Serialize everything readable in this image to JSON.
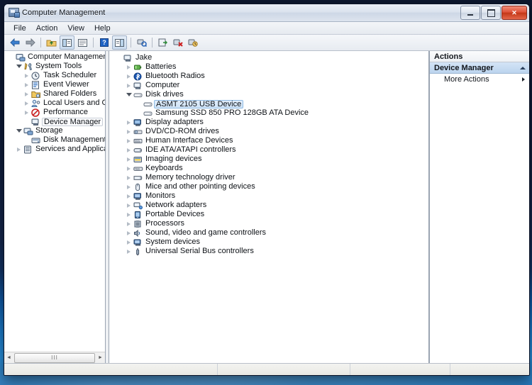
{
  "window": {
    "title": "Computer Management",
    "icon": "mmc-console-icon",
    "controls": {
      "minimize": "minimize-button",
      "maximize": "maximize-button",
      "close_label": "✕"
    }
  },
  "menubar": {
    "items": [
      {
        "label": "File"
      },
      {
        "label": "Action"
      },
      {
        "label": "View"
      },
      {
        "label": "Help"
      }
    ]
  },
  "toolbar": {
    "buttons": [
      {
        "name": "back-icon"
      },
      {
        "name": "forward-icon"
      },
      {
        "name": "up-one-level-icon"
      },
      {
        "name": "show-hide-console-tree-icon"
      },
      {
        "name": "properties-icon"
      },
      {
        "name": "help-icon"
      },
      {
        "name": "show-hide-action-pane-icon"
      },
      {
        "name": "scan-for-hardware-changes-icon"
      },
      {
        "name": "update-driver-icon"
      },
      {
        "name": "disable-device-icon"
      },
      {
        "name": "uninstall-device-icon"
      }
    ]
  },
  "sidebar": {
    "items": [
      {
        "label": "Computer Management (Local",
        "level": 0,
        "expander": "none",
        "icon": "computer-management-icon",
        "selected": false
      },
      {
        "label": "System Tools",
        "level": 1,
        "expander": "open",
        "icon": "system-tools-icon",
        "selected": false
      },
      {
        "label": "Task Scheduler",
        "level": 2,
        "expander": "closed",
        "icon": "clock-icon",
        "selected": false
      },
      {
        "label": "Event Viewer",
        "level": 2,
        "expander": "closed",
        "icon": "event-viewer-icon",
        "selected": false
      },
      {
        "label": "Shared Folders",
        "level": 2,
        "expander": "closed",
        "icon": "shared-folders-icon",
        "selected": false
      },
      {
        "label": "Local Users and Groups",
        "level": 2,
        "expander": "closed",
        "icon": "users-groups-icon",
        "selected": false
      },
      {
        "label": "Performance",
        "level": 2,
        "expander": "closed",
        "icon": "performance-icon",
        "selected": false
      },
      {
        "label": "Device Manager",
        "level": 2,
        "expander": "none",
        "icon": "device-manager-icon",
        "selected": "soft"
      },
      {
        "label": "Storage",
        "level": 1,
        "expander": "open",
        "icon": "storage-icon",
        "selected": false
      },
      {
        "label": "Disk Management",
        "level": 2,
        "expander": "none",
        "icon": "disk-management-icon",
        "selected": false
      },
      {
        "label": "Services and Applications",
        "level": 1,
        "expander": "closed",
        "icon": "services-applications-icon",
        "selected": false
      }
    ],
    "scrollbar": {
      "left_arrow": "◄",
      "right_arrow": "►",
      "grip": "III"
    }
  },
  "device_tree": {
    "items": [
      {
        "label": "Jake",
        "level": 0,
        "expander": "none",
        "icon": "computer-icon",
        "selected": false
      },
      {
        "label": "Batteries",
        "level": 1,
        "expander": "closed",
        "icon": "battery-icon",
        "selected": false
      },
      {
        "label": "Bluetooth Radios",
        "level": 1,
        "expander": "closed",
        "icon": "bluetooth-icon",
        "selected": false
      },
      {
        "label": "Computer",
        "level": 1,
        "expander": "closed",
        "icon": "computer-icon",
        "selected": false
      },
      {
        "label": "Disk drives",
        "level": 1,
        "expander": "open",
        "icon": "disk-drive-icon",
        "selected": false
      },
      {
        "label": "ASMT 2105 USB Device",
        "level": 2,
        "expander": "none",
        "icon": "disk-drive-icon",
        "selected": "blue"
      },
      {
        "label": "Samsung SSD 850 PRO 128GB ATA Device",
        "level": 2,
        "expander": "none",
        "icon": "disk-drive-icon",
        "selected": false
      },
      {
        "label": "Display adapters",
        "level": 1,
        "expander": "closed",
        "icon": "display-adapter-icon",
        "selected": false
      },
      {
        "label": "DVD/CD-ROM drives",
        "level": 1,
        "expander": "closed",
        "icon": "dvd-drive-icon",
        "selected": false
      },
      {
        "label": "Human Interface Devices",
        "level": 1,
        "expander": "closed",
        "icon": "hid-icon",
        "selected": false
      },
      {
        "label": "IDE ATA/ATAPI controllers",
        "level": 1,
        "expander": "closed",
        "icon": "ide-controller-icon",
        "selected": false
      },
      {
        "label": "Imaging devices",
        "level": 1,
        "expander": "closed",
        "icon": "imaging-device-icon",
        "selected": false
      },
      {
        "label": "Keyboards",
        "level": 1,
        "expander": "closed",
        "icon": "keyboard-icon",
        "selected": false
      },
      {
        "label": "Memory technology driver",
        "level": 1,
        "expander": "closed",
        "icon": "memory-icon",
        "selected": false
      },
      {
        "label": "Mice and other pointing devices",
        "level": 1,
        "expander": "closed",
        "icon": "mouse-icon",
        "selected": false
      },
      {
        "label": "Monitors",
        "level": 1,
        "expander": "closed",
        "icon": "monitor-icon",
        "selected": false
      },
      {
        "label": "Network adapters",
        "level": 1,
        "expander": "closed",
        "icon": "network-adapter-icon",
        "selected": false
      },
      {
        "label": "Portable Devices",
        "level": 1,
        "expander": "closed",
        "icon": "portable-device-icon",
        "selected": false
      },
      {
        "label": "Processors",
        "level": 1,
        "expander": "closed",
        "icon": "processor-icon",
        "selected": false
      },
      {
        "label": "Sound, video and game controllers",
        "level": 1,
        "expander": "closed",
        "icon": "sound-controller-icon",
        "selected": false
      },
      {
        "label": "System devices",
        "level": 1,
        "expander": "closed",
        "icon": "system-device-icon",
        "selected": false
      },
      {
        "label": "Universal Serial Bus controllers",
        "level": 1,
        "expander": "closed",
        "icon": "usb-controller-icon",
        "selected": false
      }
    ]
  },
  "actions": {
    "header": "Actions",
    "group": "Device Manager",
    "items": [
      {
        "label": "More Actions",
        "has_submenu": true
      }
    ]
  },
  "colors": {
    "selection_blue": "#cfe3f7",
    "selection_border": "#8fbbe4",
    "action_group_bg": "#bcd4ee",
    "close_button": "#c33718",
    "desktop_blue": "#1d7fcf"
  }
}
